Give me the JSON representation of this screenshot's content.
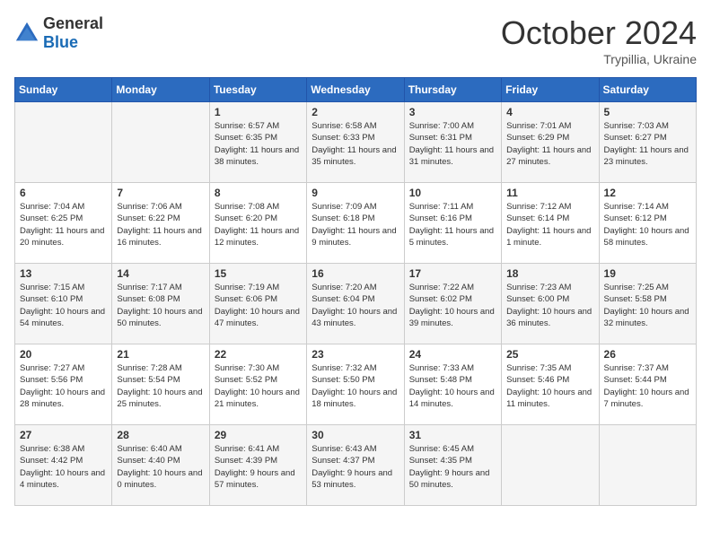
{
  "logo": {
    "general": "General",
    "blue": "Blue"
  },
  "title": {
    "month_year": "October 2024",
    "location": "Trypillia, Ukraine"
  },
  "weekdays": [
    "Sunday",
    "Monday",
    "Tuesday",
    "Wednesday",
    "Thursday",
    "Friday",
    "Saturday"
  ],
  "weeks": [
    [
      {
        "day": "",
        "sunrise": "",
        "sunset": "",
        "daylight": ""
      },
      {
        "day": "",
        "sunrise": "",
        "sunset": "",
        "daylight": ""
      },
      {
        "day": "1",
        "sunrise": "Sunrise: 6:57 AM",
        "sunset": "Sunset: 6:35 PM",
        "daylight": "Daylight: 11 hours and 38 minutes."
      },
      {
        "day": "2",
        "sunrise": "Sunrise: 6:58 AM",
        "sunset": "Sunset: 6:33 PM",
        "daylight": "Daylight: 11 hours and 35 minutes."
      },
      {
        "day": "3",
        "sunrise": "Sunrise: 7:00 AM",
        "sunset": "Sunset: 6:31 PM",
        "daylight": "Daylight: 11 hours and 31 minutes."
      },
      {
        "day": "4",
        "sunrise": "Sunrise: 7:01 AM",
        "sunset": "Sunset: 6:29 PM",
        "daylight": "Daylight: 11 hours and 27 minutes."
      },
      {
        "day": "5",
        "sunrise": "Sunrise: 7:03 AM",
        "sunset": "Sunset: 6:27 PM",
        "daylight": "Daylight: 11 hours and 23 minutes."
      }
    ],
    [
      {
        "day": "6",
        "sunrise": "Sunrise: 7:04 AM",
        "sunset": "Sunset: 6:25 PM",
        "daylight": "Daylight: 11 hours and 20 minutes."
      },
      {
        "day": "7",
        "sunrise": "Sunrise: 7:06 AM",
        "sunset": "Sunset: 6:22 PM",
        "daylight": "Daylight: 11 hours and 16 minutes."
      },
      {
        "day": "8",
        "sunrise": "Sunrise: 7:08 AM",
        "sunset": "Sunset: 6:20 PM",
        "daylight": "Daylight: 11 hours and 12 minutes."
      },
      {
        "day": "9",
        "sunrise": "Sunrise: 7:09 AM",
        "sunset": "Sunset: 6:18 PM",
        "daylight": "Daylight: 11 hours and 9 minutes."
      },
      {
        "day": "10",
        "sunrise": "Sunrise: 7:11 AM",
        "sunset": "Sunset: 6:16 PM",
        "daylight": "Daylight: 11 hours and 5 minutes."
      },
      {
        "day": "11",
        "sunrise": "Sunrise: 7:12 AM",
        "sunset": "Sunset: 6:14 PM",
        "daylight": "Daylight: 11 hours and 1 minute."
      },
      {
        "day": "12",
        "sunrise": "Sunrise: 7:14 AM",
        "sunset": "Sunset: 6:12 PM",
        "daylight": "Daylight: 10 hours and 58 minutes."
      }
    ],
    [
      {
        "day": "13",
        "sunrise": "Sunrise: 7:15 AM",
        "sunset": "Sunset: 6:10 PM",
        "daylight": "Daylight: 10 hours and 54 minutes."
      },
      {
        "day": "14",
        "sunrise": "Sunrise: 7:17 AM",
        "sunset": "Sunset: 6:08 PM",
        "daylight": "Daylight: 10 hours and 50 minutes."
      },
      {
        "day": "15",
        "sunrise": "Sunrise: 7:19 AM",
        "sunset": "Sunset: 6:06 PM",
        "daylight": "Daylight: 10 hours and 47 minutes."
      },
      {
        "day": "16",
        "sunrise": "Sunrise: 7:20 AM",
        "sunset": "Sunset: 6:04 PM",
        "daylight": "Daylight: 10 hours and 43 minutes."
      },
      {
        "day": "17",
        "sunrise": "Sunrise: 7:22 AM",
        "sunset": "Sunset: 6:02 PM",
        "daylight": "Daylight: 10 hours and 39 minutes."
      },
      {
        "day": "18",
        "sunrise": "Sunrise: 7:23 AM",
        "sunset": "Sunset: 6:00 PM",
        "daylight": "Daylight: 10 hours and 36 minutes."
      },
      {
        "day": "19",
        "sunrise": "Sunrise: 7:25 AM",
        "sunset": "Sunset: 5:58 PM",
        "daylight": "Daylight: 10 hours and 32 minutes."
      }
    ],
    [
      {
        "day": "20",
        "sunrise": "Sunrise: 7:27 AM",
        "sunset": "Sunset: 5:56 PM",
        "daylight": "Daylight: 10 hours and 28 minutes."
      },
      {
        "day": "21",
        "sunrise": "Sunrise: 7:28 AM",
        "sunset": "Sunset: 5:54 PM",
        "daylight": "Daylight: 10 hours and 25 minutes."
      },
      {
        "day": "22",
        "sunrise": "Sunrise: 7:30 AM",
        "sunset": "Sunset: 5:52 PM",
        "daylight": "Daylight: 10 hours and 21 minutes."
      },
      {
        "day": "23",
        "sunrise": "Sunrise: 7:32 AM",
        "sunset": "Sunset: 5:50 PM",
        "daylight": "Daylight: 10 hours and 18 minutes."
      },
      {
        "day": "24",
        "sunrise": "Sunrise: 7:33 AM",
        "sunset": "Sunset: 5:48 PM",
        "daylight": "Daylight: 10 hours and 14 minutes."
      },
      {
        "day": "25",
        "sunrise": "Sunrise: 7:35 AM",
        "sunset": "Sunset: 5:46 PM",
        "daylight": "Daylight: 10 hours and 11 minutes."
      },
      {
        "day": "26",
        "sunrise": "Sunrise: 7:37 AM",
        "sunset": "Sunset: 5:44 PM",
        "daylight": "Daylight: 10 hours and 7 minutes."
      }
    ],
    [
      {
        "day": "27",
        "sunrise": "Sunrise: 6:38 AM",
        "sunset": "Sunset: 4:42 PM",
        "daylight": "Daylight: 10 hours and 4 minutes."
      },
      {
        "day": "28",
        "sunrise": "Sunrise: 6:40 AM",
        "sunset": "Sunset: 4:40 PM",
        "daylight": "Daylight: 10 hours and 0 minutes."
      },
      {
        "day": "29",
        "sunrise": "Sunrise: 6:41 AM",
        "sunset": "Sunset: 4:39 PM",
        "daylight": "Daylight: 9 hours and 57 minutes."
      },
      {
        "day": "30",
        "sunrise": "Sunrise: 6:43 AM",
        "sunset": "Sunset: 4:37 PM",
        "daylight": "Daylight: 9 hours and 53 minutes."
      },
      {
        "day": "31",
        "sunrise": "Sunrise: 6:45 AM",
        "sunset": "Sunset: 4:35 PM",
        "daylight": "Daylight: 9 hours and 50 minutes."
      },
      {
        "day": "",
        "sunrise": "",
        "sunset": "",
        "daylight": ""
      },
      {
        "day": "",
        "sunrise": "",
        "sunset": "",
        "daylight": ""
      }
    ]
  ]
}
